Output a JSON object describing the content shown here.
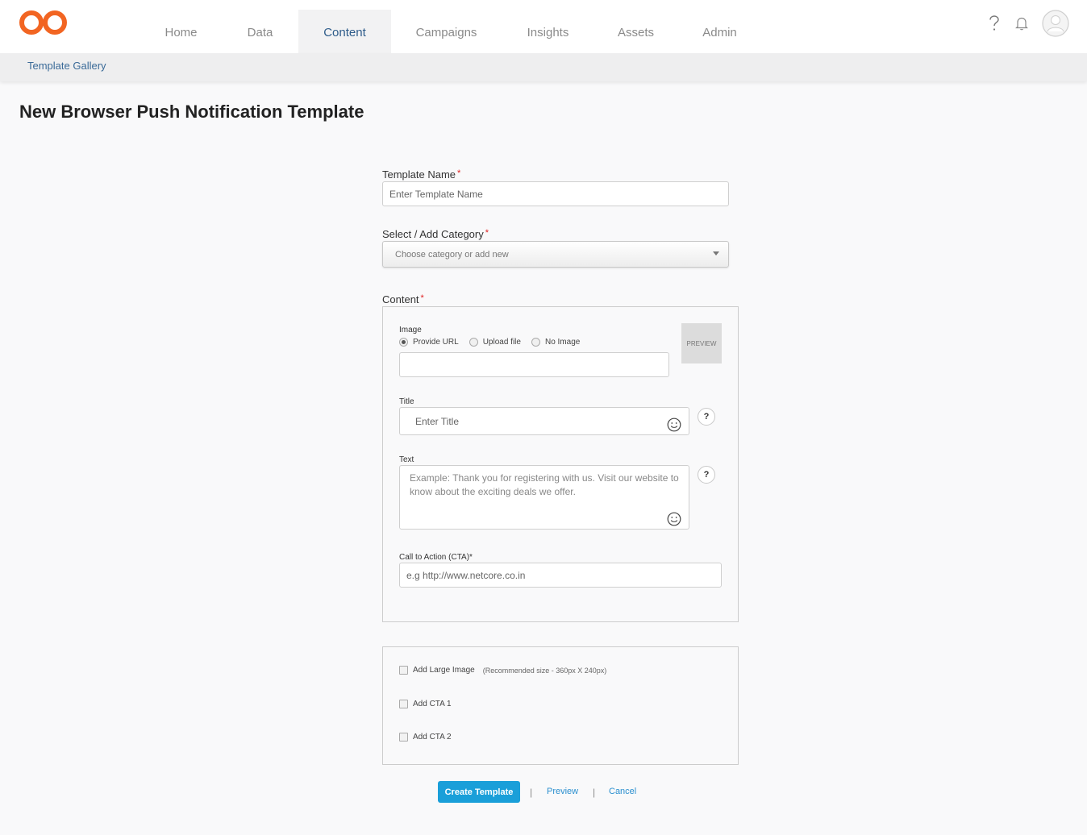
{
  "header": {
    "nav": [
      {
        "label": "Home",
        "active": false
      },
      {
        "label": "Data",
        "active": false
      },
      {
        "label": "Content",
        "active": true
      },
      {
        "label": "Campaigns",
        "active": false
      },
      {
        "label": "Insights",
        "active": false
      },
      {
        "label": "Assets",
        "active": false
      },
      {
        "label": "Admin",
        "active": false
      }
    ],
    "icons": [
      "help-icon",
      "bell-icon",
      "avatar-icon"
    ],
    "logo_color": "#f26522"
  },
  "breadcrumb": "Template Gallery",
  "page_title": "New Browser Push Notification Template",
  "form": {
    "template_name": {
      "label": "Template Name",
      "required_mark": "*",
      "placeholder": "Enter Template Name",
      "value": ""
    },
    "category": {
      "label": "Select / Add Category",
      "required_mark": "*",
      "placeholder": "Choose category or add new"
    },
    "content": {
      "label": "Content",
      "required_mark": "*",
      "image": {
        "label": "Image",
        "options": [
          "Provide URL",
          "Upload file",
          "No Image"
        ],
        "selected": "Provide URL",
        "url_value": "",
        "preview_label": "PREVIEW"
      },
      "title": {
        "label": "Title",
        "placeholder": "Enter Title",
        "help": "?"
      },
      "text": {
        "label": "Text",
        "placeholder": "Example: Thank you for registering with us. Visit our website to know about the exciting deals we offer.",
        "help": "?"
      },
      "cta": {
        "label": "Call to Action (CTA)*",
        "placeholder": "e.g http://www.netcore.co.in"
      }
    },
    "extras": {
      "large_image": {
        "label": "Add Large Image",
        "hint": "(Recommended size - 360px X 240px)",
        "checked": false
      },
      "cta1": {
        "label": "Add CTA 1",
        "checked": false
      },
      "cta2": {
        "label": "Add CTA 2",
        "checked": false
      }
    }
  },
  "actions": {
    "create": "Create Template",
    "separator": "|",
    "preview": "Preview",
    "cancel": "Cancel"
  },
  "colors": {
    "accent": "#1a9fd9",
    "active_tab_text": "#2e5c8a",
    "required": "#e02020"
  }
}
